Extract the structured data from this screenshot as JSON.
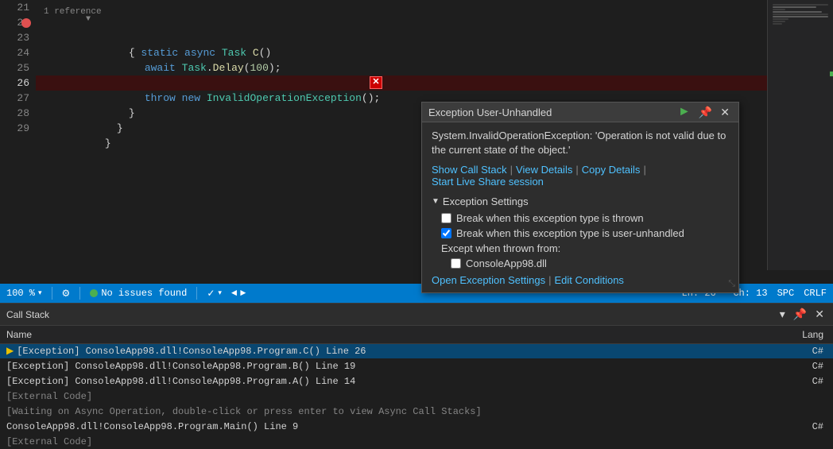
{
  "editor": {
    "lines": [
      {
        "num": "21",
        "code": "",
        "type": "normal"
      },
      {
        "num": "22",
        "code": "        static async Task C()",
        "type": "normal"
      },
      {
        "num": "23",
        "code": "        {",
        "type": "normal"
      },
      {
        "num": "24",
        "code": "            await Task.Delay(100);",
        "type": "normal"
      },
      {
        "num": "25",
        "code": "",
        "type": "normal"
      },
      {
        "num": "26",
        "code": "            throw new InvalidOperationException();",
        "type": "exception"
      },
      {
        "num": "27",
        "code": "        }",
        "type": "normal"
      },
      {
        "num": "28",
        "code": "        }",
        "type": "normal"
      },
      {
        "num": "29",
        "code": "    }",
        "type": "normal"
      }
    ],
    "ref_label": "1 reference"
  },
  "exception_popup": {
    "title": "Exception User-Unhandled",
    "message": "System.InvalidOperationException: 'Operation is not valid due to the current state of the object.'",
    "links": [
      {
        "label": "Show Call Stack"
      },
      {
        "label": "View Details"
      },
      {
        "label": "Copy Details"
      },
      {
        "label": "Start Live Share session"
      }
    ],
    "settings_header": "Exception Settings",
    "checkbox1_label": "Break when this exception type is thrown",
    "checkbox1_checked": false,
    "checkbox2_label": "Break when this exception type is user-unhandled",
    "checkbox2_checked": true,
    "except_when_label": "Except when thrown from:",
    "dll_label": "ConsoleApp98.dll",
    "footer_links": [
      {
        "label": "Open Exception Settings"
      },
      {
        "label": "Edit Conditions"
      }
    ]
  },
  "status_bar": {
    "zoom": "100 %",
    "issues": "No issues found",
    "line": "Ln: 26",
    "col": "Ch: 13",
    "encoding": "SPC",
    "line_ending": "CRLF"
  },
  "call_stack": {
    "title": "Call Stack",
    "columns": [
      "Name",
      "Lang"
    ],
    "rows": [
      {
        "name": "[Exception] ConsoleApp98.dll!ConsoleApp98.Program.C() Line 26",
        "lang": "C#",
        "selected": true,
        "arrow": true,
        "external": false,
        "async_wait": false
      },
      {
        "name": "[Exception] ConsoleApp98.dll!ConsoleApp98.Program.B() Line 19",
        "lang": "C#",
        "selected": false,
        "arrow": false,
        "external": false,
        "async_wait": false
      },
      {
        "name": "[Exception] ConsoleApp98.dll!ConsoleApp98.Program.A() Line 14",
        "lang": "C#",
        "selected": false,
        "arrow": false,
        "external": false,
        "async_wait": false
      },
      {
        "name": "[External Code]",
        "lang": "",
        "selected": false,
        "arrow": false,
        "external": true,
        "async_wait": false
      },
      {
        "name": "[Waiting on Async Operation, double-click or press enter to view Async Call Stacks]",
        "lang": "",
        "selected": false,
        "arrow": false,
        "external": false,
        "async_wait": true
      },
      {
        "name": "ConsoleApp98.dll!ConsoleApp98.Program.Main() Line 9",
        "lang": "C#",
        "selected": false,
        "arrow": false,
        "external": false,
        "async_wait": false
      },
      {
        "name": "[External Code]",
        "lang": "",
        "selected": false,
        "arrow": false,
        "external": true,
        "async_wait": false
      }
    ]
  }
}
